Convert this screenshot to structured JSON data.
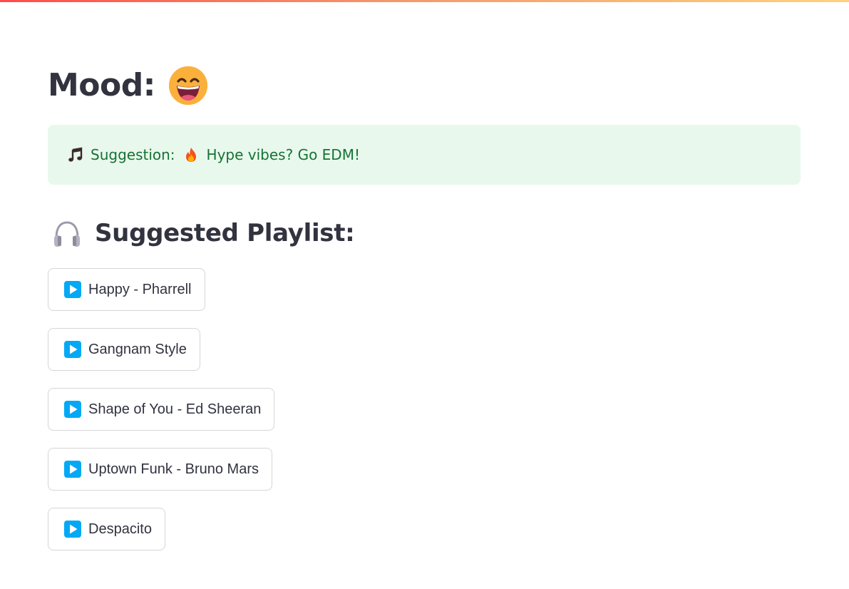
{
  "header": {
    "mood_label": "Mood:",
    "mood_emoji_icon": "grinning-face-icon"
  },
  "suggestion": {
    "prefix": "Suggestion:",
    "text": "Hype vibes? Go EDM!",
    "note_icon": "music-note-icon",
    "fire_icon": "fire-icon",
    "background": "#e8f8ed",
    "text_color": "#177233"
  },
  "playlist": {
    "title": "Suggested Playlist:",
    "icon": "headphones-icon",
    "songs": [
      {
        "label": "Happy - Pharrell"
      },
      {
        "label": "Gangnam Style"
      },
      {
        "label": "Shape of You - Ed Sheeran"
      },
      {
        "label": "Uptown Funk - Bruno Mars"
      },
      {
        "label": "Despacito"
      }
    ],
    "play_icon": "play-button-icon",
    "play_icon_color": "#03a9f4"
  }
}
